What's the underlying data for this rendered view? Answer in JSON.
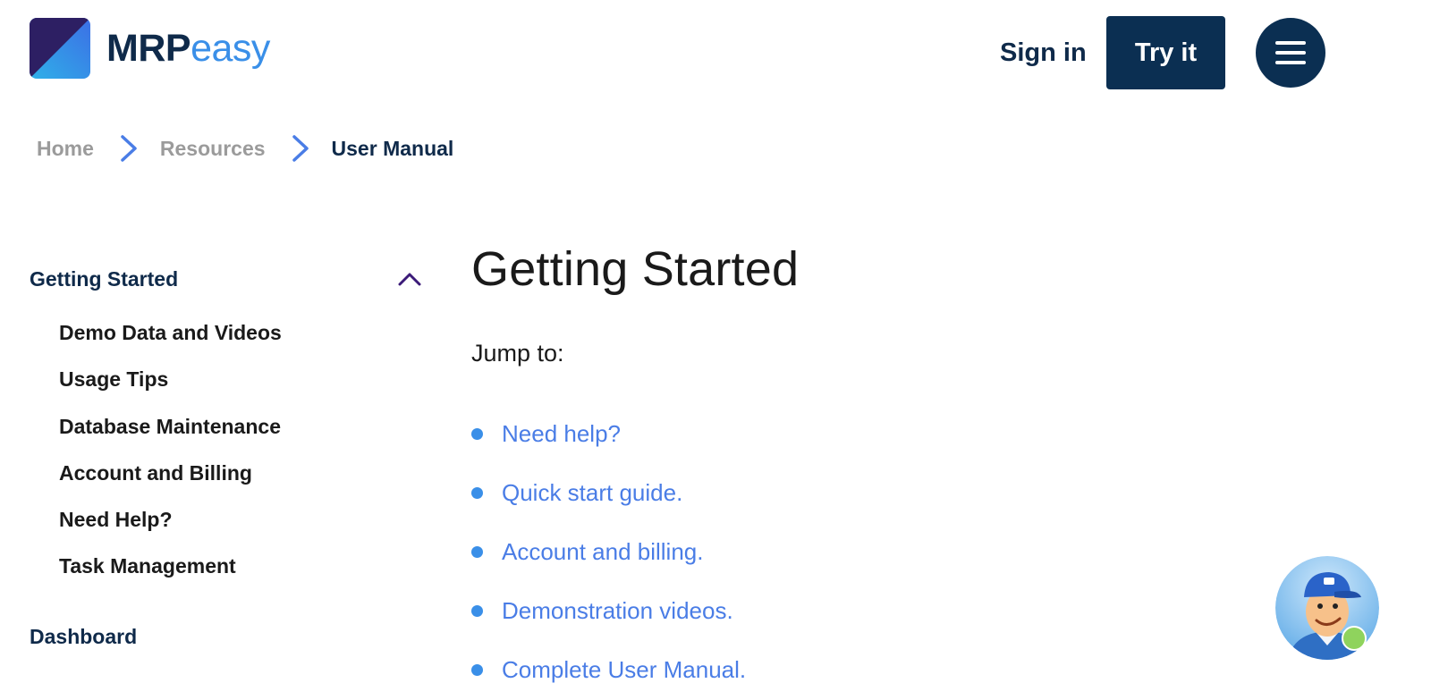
{
  "brand": {
    "mrp": "MRP",
    "easy": "easy",
    "logo_icon": "mrpeasy-logo-icon"
  },
  "header": {
    "signin_label": "Sign in",
    "tryit_label": "Try it",
    "menu_icon": "hamburger-menu-icon"
  },
  "breadcrumb": {
    "items": [
      "Home",
      "Resources",
      "User Manual"
    ],
    "separator_icon": "chevron-right-icon"
  },
  "sidebar": {
    "section_title": "Getting Started",
    "expanded_icon": "chevron-up-icon",
    "items": [
      "Demo Data and Videos",
      "Usage Tips",
      "Database Maintenance",
      "Account and Billing",
      "Need Help?",
      "Task Management"
    ],
    "next_section": "Dashboard"
  },
  "main": {
    "title": "Getting Started",
    "jump_label": "Jump to:",
    "links": [
      "Need help?",
      "Quick start guide.",
      "Account and billing.",
      "Demonstration videos.",
      "Complete User Manual."
    ]
  },
  "chat": {
    "avatar_icon": "support-agent-avatar-icon",
    "status": "online"
  },
  "colors": {
    "navy": "#0b2f52",
    "accent_blue": "#3a8fe8",
    "link_blue": "#4a7de6",
    "chevron_purple": "#3b1a78",
    "muted_gray": "#9b9b9b",
    "online_green": "#8fd35d"
  }
}
